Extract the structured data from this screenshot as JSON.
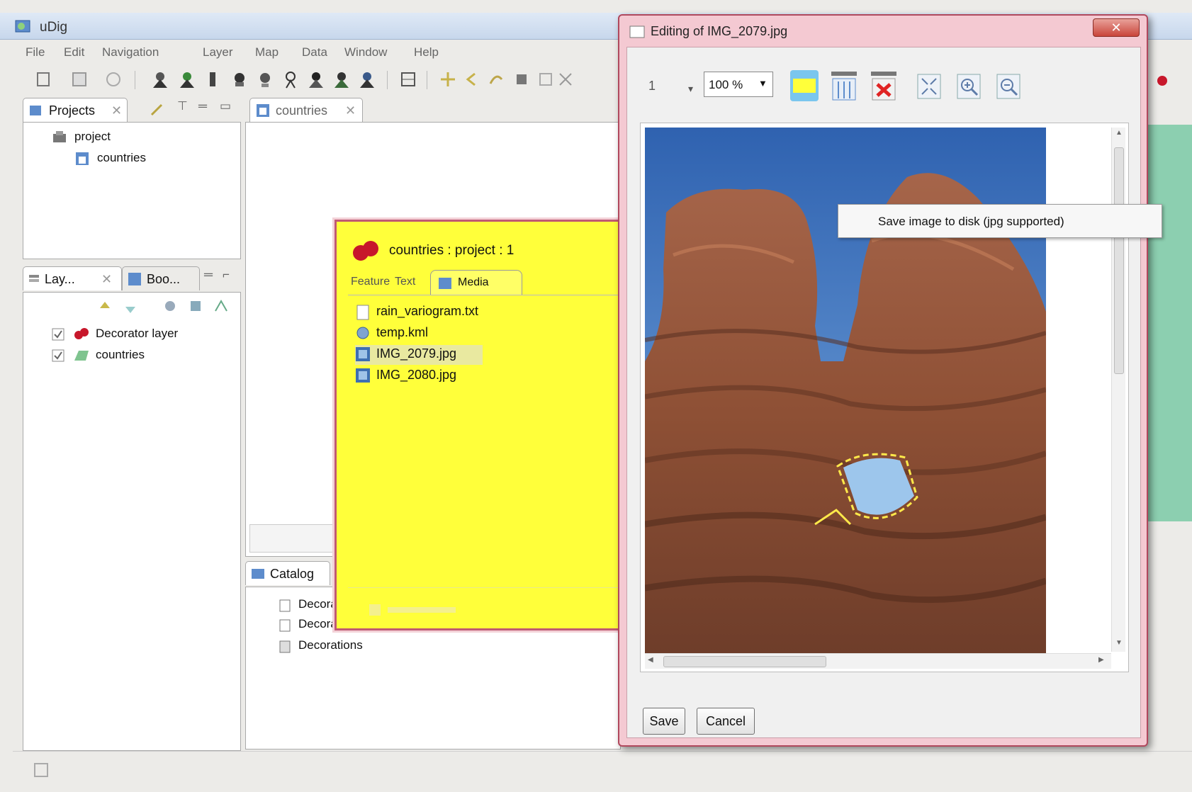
{
  "main_window": {
    "title": "uDig",
    "menu": [
      "File",
      "Edit",
      "Navigation",
      "Layer",
      "Map",
      "Data",
      "Window",
      "Help"
    ],
    "projects_view": {
      "tab_label": "Projects",
      "tree": [
        {
          "label": "project",
          "icon": "project-icon"
        },
        {
          "label": "countries",
          "icon": "map-icon"
        }
      ]
    },
    "layers_view": {
      "tab_label": "Lay...",
      "tab2_label": "Boo...",
      "layers": [
        {
          "label": "Decorator layer",
          "checked": true,
          "icon": "decorator-icon"
        },
        {
          "label": "countries",
          "checked": true,
          "icon": "layer-icon"
        }
      ]
    },
    "map_editor": {
      "tab_label": "countries"
    },
    "catalog_view": {
      "tab_label": "Catalog",
      "items": [
        "Decorators",
        "Decorators",
        "Decorations"
      ]
    },
    "status_text": ""
  },
  "info_popup": {
    "title": "countries : project : 1",
    "tabs": [
      "Feature",
      "Text",
      "Media"
    ],
    "active_tab": "Media",
    "files": [
      {
        "label": "rain_variogram.txt",
        "icon": "text-file-icon"
      },
      {
        "label": "temp.kml",
        "icon": "globe-icon"
      },
      {
        "label": "IMG_2079.jpg",
        "icon": "image-file-icon",
        "selected": true
      },
      {
        "label": "IMG_2080.jpg",
        "icon": "image-file-icon"
      }
    ]
  },
  "editing_dialog": {
    "title": "Editing of IMG_2079.jpg",
    "zoom_value": "100 %",
    "context_menu_item": "Save image to disk (jpg supported)",
    "save_label": "Save",
    "cancel_label": "Cancel",
    "colors": {
      "sky": "#4a7fc4",
      "rock": "#9a5a3a",
      "accent_yellow": "#ffff3a",
      "dialog_frame": "#f4c9d2"
    }
  }
}
